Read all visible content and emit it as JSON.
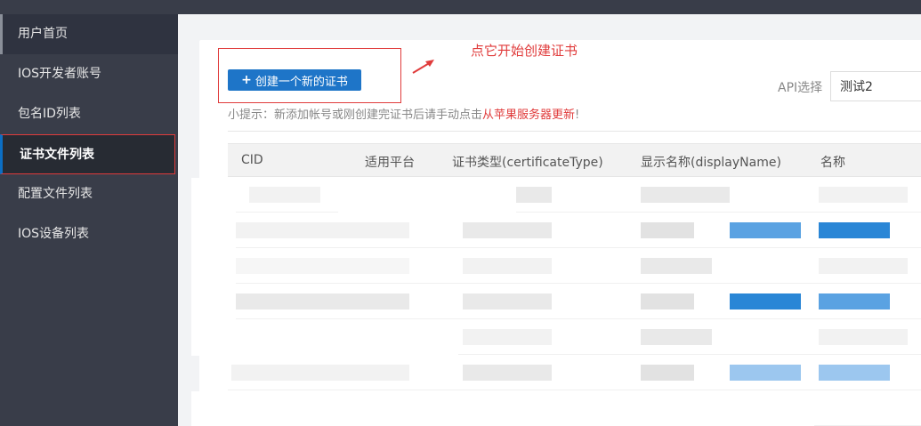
{
  "sidebar": {
    "items": [
      {
        "label": "用户首页"
      },
      {
        "label": "IOS开发者账号"
      },
      {
        "label": "包名ID列表"
      },
      {
        "label": "证书文件列表"
      },
      {
        "label": "配置文件列表"
      },
      {
        "label": "IOS设备列表"
      }
    ]
  },
  "toolbar": {
    "create_label": "创建一个新的证书",
    "annotation": "点它开始创建证书",
    "api_label": "API选择",
    "api_value": "测试2"
  },
  "tip": {
    "prefix": "小提示：新添加帐号或刚创建完证书后请手动点击",
    "link": "从苹果服务器更新",
    "suffix": "!"
  },
  "table": {
    "columns": [
      "CID",
      "适用平台",
      "证书类型(certificateType)",
      "显示名称(displayName)",
      "名称"
    ]
  },
  "colors": {
    "sidebar_bg": "#393d49",
    "accent_blue": "#1e75c8",
    "annotation_red": "#e03b3b"
  }
}
